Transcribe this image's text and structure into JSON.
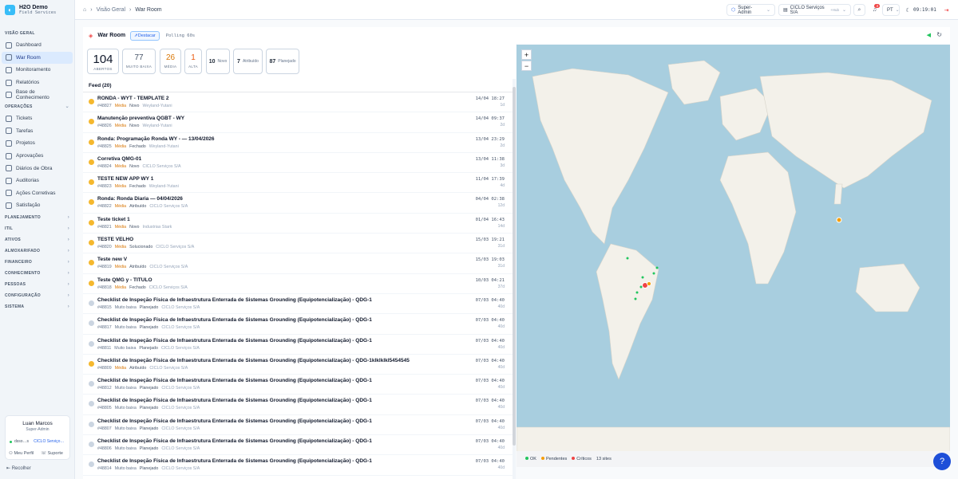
{
  "brand": {
    "name": "H2O Demo",
    "sub": "Field Services"
  },
  "breadcrumb": [
    "Visão Geral",
    "War Room"
  ],
  "topbar": {
    "role": "Super-Admin",
    "company": "CICLO Serviços S/A",
    "company_tag": "+Hub",
    "notifications": "3",
    "lang": "PT",
    "clock": "09:19:01"
  },
  "sidebar": {
    "visao_label": "VISÃO GERAL",
    "visao": [
      "Dashboard",
      "War Room",
      "Monitoramento",
      "Relatórios",
      "Base de Conhecimento"
    ],
    "operacoes_label": "OPERAÇÕES",
    "operacoes": [
      "Tickets",
      "Tarefas",
      "Projetos",
      "Aprovações",
      "Diários de Obra",
      "Auditorias",
      "Ações Corretivas",
      "Satisfação"
    ],
    "groups": [
      "PLANEJAMENTO",
      "ITIL",
      "ATIVOS",
      "ALMOXARIFADO",
      "FINANCEIRO",
      "CONHECIMENTO",
      "PESSOAS",
      "CONFIGURAÇÃO",
      "SISTEMA"
    ]
  },
  "user": {
    "name": "Luan Marcos",
    "role": "Super-Admin",
    "email": "dsso…s",
    "company": "CICLO Serviço…",
    "profile": "Meu Perfil",
    "support": "Suporte"
  },
  "collapse_label": "Recolher",
  "panel": {
    "title": "War Room",
    "highlight": "Destacar",
    "polling": "Polling 60s"
  },
  "stats": {
    "abertos": "104",
    "abertos_label": "ABERTOS",
    "muito_baixa": "77",
    "muito_baixa_label": "MUITO BAIXA",
    "media": "26",
    "media_label": "MÉDIA",
    "alta": "1",
    "alta_label": "ALTA",
    "novo": "10",
    "novo_label": "Novo",
    "atribuido": "7",
    "atribuido_label": "Atribuído",
    "planejado": "87",
    "planejado_label": "Planejado"
  },
  "feed": {
    "title": "Feed (20)",
    "items": [
      {
        "title": "RONDA - WYT - TEMPLATE 2",
        "id": "#48827",
        "priority": "Média",
        "status": "Novo",
        "client": "Weyland-Yutani",
        "date": "14/04 18:27",
        "age": "1d",
        "color": "#f5b82e"
      },
      {
        "title": "Manutenção preventiva QGBT - WY",
        "id": "#48826",
        "priority": "Média",
        "status": "Novo",
        "client": "Weyland-Yutani",
        "date": "14/04 09:37",
        "age": "2d",
        "color": "#f5b82e"
      },
      {
        "title": "Ronda: Programação Ronda WY - — 13/04/2026",
        "id": "#48825",
        "priority": "Média",
        "status": "Fechado",
        "client": "Weyland-Yutani",
        "date": "13/04 23:29",
        "age": "2d",
        "color": "#f5b82e"
      },
      {
        "title": "Corretiva QMG-01",
        "id": "#48824",
        "priority": "Média",
        "status": "Novo",
        "client": "CICLO Serviços S/A",
        "date": "13/04 11:38",
        "age": "3d",
        "color": "#f5b82e"
      },
      {
        "title": "TESTE NEW APP WY 1",
        "id": "#48823",
        "priority": "Média",
        "status": "Fechado",
        "client": "Weyland-Yutani",
        "date": "11/04 17:39",
        "age": "4d",
        "color": "#f5b82e"
      },
      {
        "title": "Ronda: Ronda Diaria — 04/04/2026",
        "id": "#48822",
        "priority": "Média",
        "status": "Atribuído",
        "client": "CICLO Serviços S/A",
        "date": "04/04 02:38",
        "age": "12d",
        "color": "#f5b82e"
      },
      {
        "title": "Teste ticket 1",
        "id": "#48821",
        "priority": "Média",
        "status": "Novo",
        "client": "Industrias Stark",
        "date": "01/04 16:43",
        "age": "14d",
        "color": "#f5b82e"
      },
      {
        "title": "TESTE VELHO",
        "id": "#48820",
        "priority": "Média",
        "status": "Solucionado",
        "client": "CICLO Serviços S/A",
        "date": "15/03 19:21",
        "age": "31d",
        "color": "#f5b82e"
      },
      {
        "title": "Teste new V",
        "id": "#48819",
        "priority": "Média",
        "status": "Atribuído",
        "client": "CICLO Serviços S/A",
        "date": "15/03 19:03",
        "age": "31d",
        "color": "#f5b82e"
      },
      {
        "title": "Teste QMG y - TITULO",
        "id": "#48818",
        "priority": "Média",
        "status": "Fechado",
        "client": "CICLO Serviços S/A",
        "date": "10/03 04:21",
        "age": "37d",
        "color": "#f5b82e"
      },
      {
        "title": "Checklist de Inspeção Física de Infraestrutura Enterrada de Sistemas Grounding (Equipotencialização) - QDG-1",
        "id": "#48815",
        "priority": "Muito baixa",
        "status": "Planejado",
        "client": "CICLO Serviços S/A",
        "date": "07/03 04:40",
        "age": "40d",
        "color": "#cbd5e1"
      },
      {
        "title": "Checklist de Inspeção Física de Infraestrutura Enterrada de Sistemas Grounding (Equipotencialização) - QDG-1",
        "id": "#48817",
        "priority": "Muito baixa",
        "status": "Planejado",
        "client": "CICLO Serviços S/A",
        "date": "07/03 04:40",
        "age": "40d",
        "color": "#cbd5e1"
      },
      {
        "title": "Checklist de Inspeção Física de Infraestrutura Enterrada de Sistemas Grounding (Equipotencialização) - QDG-1",
        "id": "#48811",
        "priority": "Muito baixa",
        "status": "Planejado",
        "client": "CICLO Serviços S/A",
        "date": "07/03 04:40",
        "age": "40d",
        "color": "#cbd5e1"
      },
      {
        "title": "Checklist de Inspeção Física de Infraestrutura Enterrada de Sistemas Grounding (Equipotencialização) - QDG-1klklklkl5454545",
        "id": "#48809",
        "priority": "Média",
        "status": "Atribuído",
        "client": "CICLO Serviços S/A",
        "date": "07/03 04:40",
        "age": "40d",
        "color": "#f5b82e"
      },
      {
        "title": "Checklist de Inspeção Física de Infraestrutura Enterrada de Sistemas Grounding (Equipotencialização) - QDG-1",
        "id": "#48812",
        "priority": "Muito baixa",
        "status": "Planejado",
        "client": "CICLO Serviços S/A",
        "date": "07/03 04:40",
        "age": "40d",
        "color": "#cbd5e1"
      },
      {
        "title": "Checklist de Inspeção Física de Infraestrutura Enterrada de Sistemas Grounding (Equipotencialização) - QDG-1",
        "id": "#48805",
        "priority": "Muito baixa",
        "status": "Planejado",
        "client": "CICLO Serviços S/A",
        "date": "07/03 04:40",
        "age": "40d",
        "color": "#cbd5e1"
      },
      {
        "title": "Checklist de Inspeção Física de Infraestrutura Enterrada de Sistemas Grounding (Equipotencialização) - QDG-1",
        "id": "#48807",
        "priority": "Muito baixa",
        "status": "Planejado",
        "client": "CICLO Serviços S/A",
        "date": "07/03 04:40",
        "age": "40d",
        "color": "#cbd5e1"
      },
      {
        "title": "Checklist de Inspeção Física de Infraestrutura Enterrada de Sistemas Grounding (Equipotencialização) - QDG-1",
        "id": "#48806",
        "priority": "Muito baixa",
        "status": "Planejado",
        "client": "CICLO Serviços S/A",
        "date": "07/03 04:40",
        "age": "40d",
        "color": "#cbd5e1"
      },
      {
        "title": "Checklist de Inspeção Física de Infraestrutura Enterrada de Sistemas Grounding (Equipotencialização) - QDG-1",
        "id": "#48814",
        "priority": "Muito baixa",
        "status": "Planejado",
        "client": "CICLO Serviços S/A",
        "date": "07/03 04:40",
        "age": "40d",
        "color": "#cbd5e1"
      }
    ]
  },
  "map": {
    "zoom_in": "+",
    "zoom_out": "−"
  },
  "legend": {
    "ok": "OK",
    "pendentes": "Pendentes",
    "criticos": "Críticos",
    "sites": "13 sites",
    "ok_color": "#22c55e",
    "pend_color": "#f59e0b",
    "crit_color": "#ef4444"
  },
  "colors": {
    "accent": "#2563eb",
    "active_nav": "#dbeafe",
    "media": "#f5b82e"
  }
}
